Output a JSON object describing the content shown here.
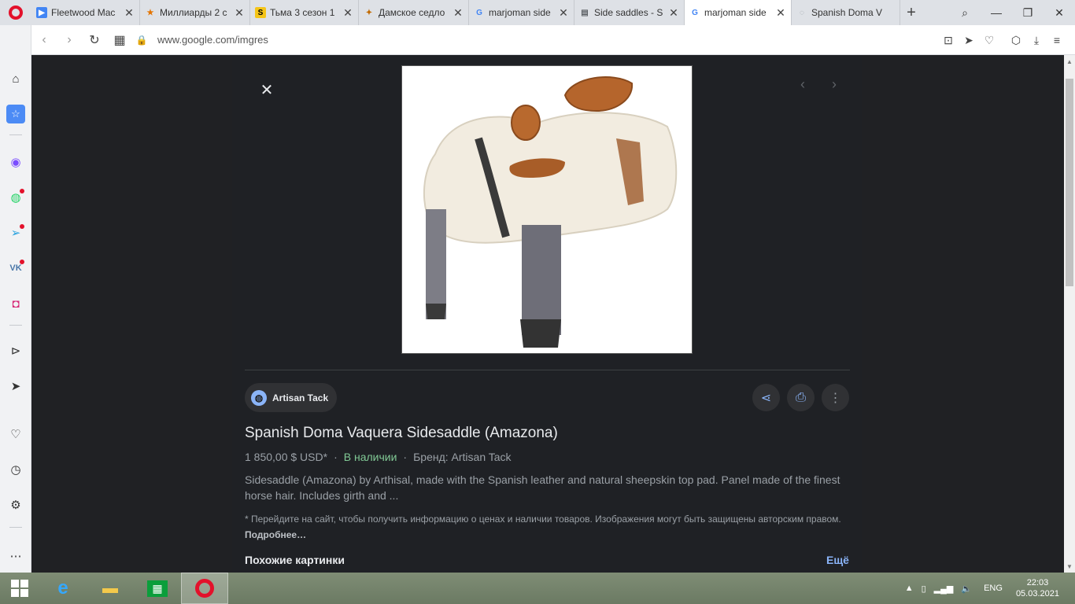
{
  "tabs": [
    {
      "title": "Fleetwood Mac",
      "favicon": "▶",
      "favicon_color": "#4285f4"
    },
    {
      "title": "Миллиарды 2 с",
      "favicon": "★",
      "favicon_color": "#e37400"
    },
    {
      "title": "Тьма 3 сезон 1",
      "favicon": "S",
      "favicon_color": "#f5c518"
    },
    {
      "title": "Дамское седло",
      "favicon": "✦",
      "favicon_color": "#c26a00"
    },
    {
      "title": "marjoman side",
      "favicon": "G",
      "favicon_color": "#4285f4"
    },
    {
      "title": "Side saddles - S",
      "favicon": "▤",
      "favicon_color": "#5f6368"
    },
    {
      "title": "marjoman side",
      "favicon": "G",
      "favicon_color": "#4285f4",
      "active": true
    },
    {
      "title": "Spanish Doma V",
      "favicon": "◌",
      "favicon_color": "#9aa0a6"
    }
  ],
  "address": {
    "url": "www.google.com/imgres"
  },
  "viewer": {
    "source": "Artisan Tack",
    "title": "Spanish Doma Vaquera Sidesaddle (Amazona)",
    "price": "1 850,00 $ USD*",
    "stock": "В наличии",
    "brand": "Бренд: Artisan Tack",
    "description": "Sidesaddle (Amazona) by Arthisal, made with the Spanish leather and natural sheepskin top pad. Panel made of the finest horse hair. Includes girth and ...",
    "note": "* Перейдите на сайт, чтобы получить информацию о ценах и наличии товаров. Изображения могут быть защищены авторским правом.",
    "note_more": "Подробнее…",
    "similar_label": "Похожие картинки",
    "more_label": "Ещё"
  },
  "taskbar": {
    "lang": "ENG",
    "time": "22:03",
    "date": "05.03.2021"
  },
  "colors": {
    "accent": "#8ab4f8",
    "stock_green": "#81c995",
    "opera_red": "#e3112b"
  }
}
